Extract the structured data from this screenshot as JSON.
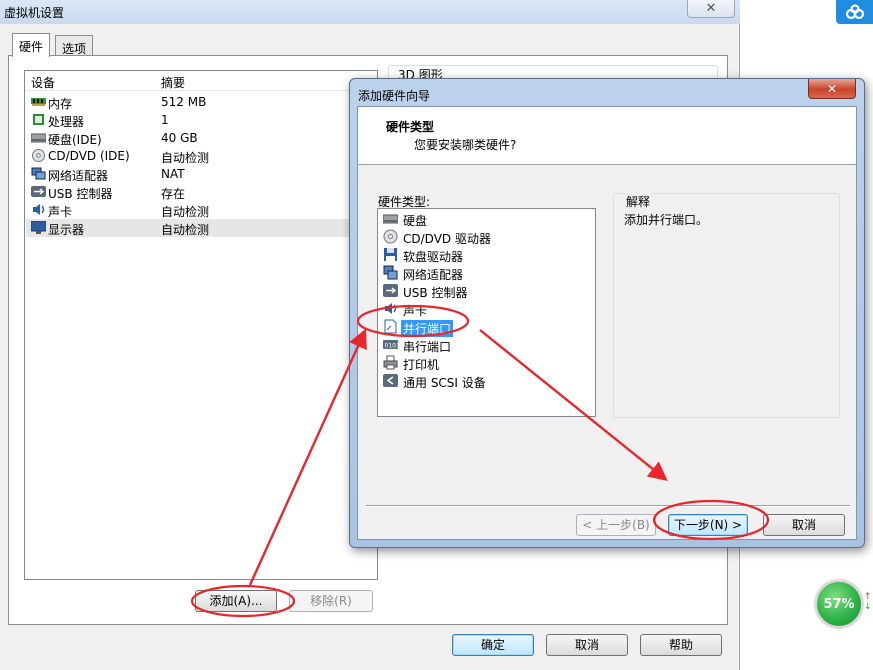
{
  "main_dialog": {
    "title": "虚拟机设置",
    "close_glyph": "✕",
    "tabs": [
      {
        "label": "硬件"
      },
      {
        "label": "选项"
      }
    ],
    "device_list": {
      "columns": [
        "设备",
        "摘要"
      ],
      "rows": [
        {
          "name": "内存",
          "summary": "512 MB",
          "icon": "memory-icon"
        },
        {
          "name": "处理器",
          "summary": "1",
          "icon": "processor-icon"
        },
        {
          "name": "硬盘(IDE)",
          "summary": "40 GB",
          "icon": "hard-disk-icon"
        },
        {
          "name": "CD/DVD (IDE)",
          "summary": "自动检测",
          "icon": "cd-dvd-icon"
        },
        {
          "name": "网络适配器",
          "summary": "NAT",
          "icon": "network-adapter-icon"
        },
        {
          "name": "USB 控制器",
          "summary": "存在",
          "icon": "usb-icon"
        },
        {
          "name": "声卡",
          "summary": "自动检测",
          "icon": "sound-card-icon"
        },
        {
          "name": "显示器",
          "summary": "自动检测",
          "icon": "display-icon"
        }
      ]
    },
    "side_section_label": "3D 图形",
    "buttons": {
      "add": "添加(A)...",
      "remove": "移除(R)",
      "ok": "确定",
      "cancel": "取消",
      "help": "帮助"
    }
  },
  "wizard": {
    "title": "添加硬件向导",
    "close_glyph": "✕",
    "header_title": "硬件类型",
    "header_subtitle": "您要安装哪类硬件?",
    "list_label": "硬件类型:",
    "hardware_types": [
      {
        "label": "硬盘",
        "icon": "hard-disk-icon"
      },
      {
        "label": "CD/DVD 驱动器",
        "icon": "cd-dvd-icon"
      },
      {
        "label": "软盘驱动器",
        "icon": "floppy-icon"
      },
      {
        "label": "网络适配器",
        "icon": "network-adapter-icon"
      },
      {
        "label": "USB 控制器",
        "icon": "usb-icon"
      },
      {
        "label": "声卡",
        "icon": "sound-card-icon"
      },
      {
        "label": "并行端口",
        "icon": "parallel-port-icon",
        "selected": true
      },
      {
        "label": "串行端口",
        "icon": "serial-port-icon"
      },
      {
        "label": "打印机",
        "icon": "printer-icon"
      },
      {
        "label": "通用 SCSI 设备",
        "icon": "scsi-icon"
      }
    ],
    "explanation_label": "解释",
    "explanation_text": "添加并行端口。",
    "buttons": {
      "back": "< 上一步(B)",
      "next": "下一步(N) >",
      "cancel": "取消"
    }
  },
  "system": {
    "gauge_percent": "57%",
    "up_arrow": "↑",
    "down_arrow": "↓"
  },
  "colors": {
    "annotation_red": "#e8262b",
    "selection_blue": "#3399ff",
    "gauge_green": "#2fb34a",
    "cloud_blue": "#1f8ee0"
  }
}
